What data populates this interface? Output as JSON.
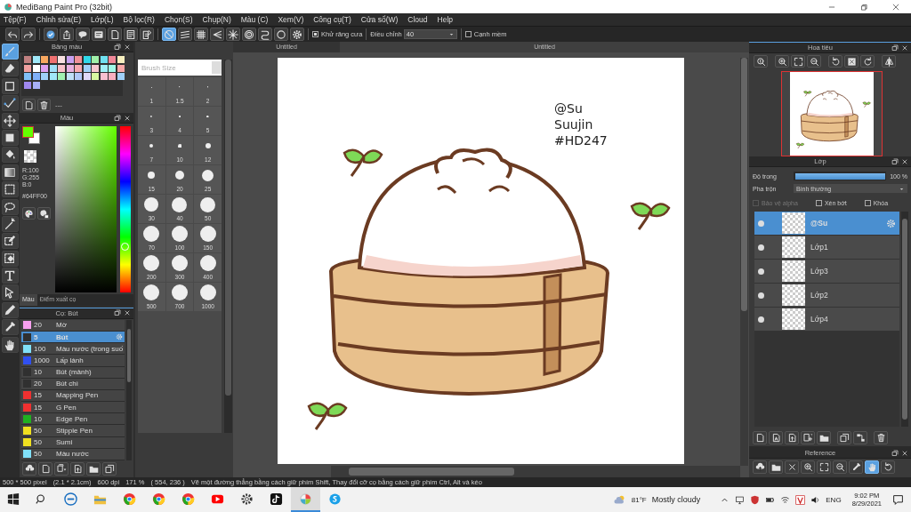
{
  "window": {
    "title": "MediBang Paint Pro (32bit)"
  },
  "menu": [
    "Tệp(F)",
    "Chỉnh sửa(E)",
    "Lớp(L)",
    "Bộ lọc(R)",
    "Chọn(S)",
    "Chụp(N)",
    "Màu (C)",
    "Xem(V)",
    "Công cụ(T)",
    "Cửa sổ(W)",
    "Cloud",
    "Help"
  ],
  "toolbar": {
    "snaps": [
      {
        "selected": true
      },
      {
        "selected": false
      },
      {
        "selected": false
      },
      {
        "selected": false
      },
      {
        "selected": false
      },
      {
        "selected": false
      },
      {
        "selected": false
      },
      {
        "selected": false
      }
    ],
    "antialias": {
      "label": "Khử răng cưa",
      "checked": true
    },
    "correction": {
      "label": "Điều chỉnh",
      "value": "40"
    },
    "soft_edge": {
      "label": "Cạnh mềm",
      "checked": false
    }
  },
  "tools": [
    {
      "selected": true
    },
    {
      "selected": false
    },
    {
      "selected": false
    },
    {
      "selected": false
    },
    {
      "selected": false
    },
    {
      "selected": false
    },
    {
      "selected": false
    },
    {
      "selected": false
    },
    {
      "selected": false
    },
    {
      "selected": false
    },
    {
      "selected": false
    },
    {
      "selected": false
    },
    {
      "selected": false
    },
    {
      "selected": false
    },
    {
      "selected": false
    },
    {
      "selected": false
    },
    {
      "selected": false
    },
    {
      "selected": false
    }
  ],
  "palette": {
    "title": "Bảng màu",
    "set_name": "---",
    "swatches": [
      {
        "color": "#c08080"
      },
      {
        "color": "#a0e8f8"
      },
      {
        "color": "#f8a860"
      },
      {
        "color": "#f07070"
      },
      {
        "color": "#f8e0e0"
      },
      {
        "color": "#c8a0f0"
      },
      {
        "color": "#f09098"
      },
      {
        "color": "#30d8e8"
      },
      {
        "color": "#a0f0a8"
      },
      {
        "color": "#70e0f0"
      },
      {
        "color": "#f08898"
      },
      {
        "color": "#f8f0c0"
      },
      {
        "color": "#f0a0a0"
      },
      {
        "color": "#ffffff"
      },
      {
        "color": "#e0a0f0"
      },
      {
        "color": "#a0e0f8"
      },
      {
        "color": "#f8c0c8"
      },
      {
        "color": "#e8b0e0"
      },
      {
        "color": "#f8a8b0"
      },
      {
        "color": "#a0d0f8"
      },
      {
        "color": "#f8c8d0"
      },
      {
        "color": "#a0f0f8"
      },
      {
        "color": "#a0f8e8"
      },
      {
        "color": "#f8a8a8"
      },
      {
        "color": "#80c0f8"
      },
      {
        "color": "#80b0f8"
      },
      {
        "color": "#a0d0f8"
      },
      {
        "color": "#a0e8f8"
      },
      {
        "color": "#a0f0b0"
      },
      {
        "color": "#c0e0f8"
      },
      {
        "color": "#b0c8f8"
      },
      {
        "color": "#e0d8f8"
      },
      {
        "color": "#d8f8a0"
      },
      {
        "color": "#f8c0d0"
      },
      {
        "color": "#f8b0c0"
      },
      {
        "color": "#a0d0f8"
      },
      {
        "color": "#a088f0"
      },
      {
        "color": "#a8b0f8"
      }
    ]
  },
  "color_panel": {
    "title": "Màu",
    "swatches": [
      {
        "kind": "foreground",
        "color": "#64ff00"
      },
      {
        "kind": "background",
        "color": "#ffffff"
      }
    ],
    "r": "R:100",
    "g": "G:255",
    "b": "B:0",
    "hex": "#64FF00",
    "hue": {
      "level": 0.27
    },
    "tabs": [
      {
        "label": "Màu",
        "selected": true
      },
      {
        "label": "Điểm xuất cọ",
        "selected": false
      }
    ]
  },
  "brush_panel": {
    "title": "Cọ: Bút",
    "brushes": [
      {
        "color": "#f8a0f0",
        "size": "20",
        "name": "Mờ",
        "selected": false
      },
      {
        "color": "#303030",
        "size": "5",
        "name": "Bút",
        "selected": true
      },
      {
        "color": "#80e0f8",
        "size": "100",
        "name": "Màu nước (trong suố",
        "selected": false
      },
      {
        "color": "#3050f0",
        "size": "1000",
        "name": "Lấp lánh",
        "selected": false
      },
      {
        "color": "#303030",
        "size": "10",
        "name": "Bút (mảnh)",
        "selected": false
      },
      {
        "color": "#303030",
        "size": "20",
        "name": "Bút chì",
        "selected": false
      },
      {
        "color": "#f03030",
        "size": "15",
        "name": "Mapping Pen",
        "selected": false
      },
      {
        "color": "#f03030",
        "size": "15",
        "name": "G Pen",
        "selected": false
      },
      {
        "color": "#20b020",
        "size": "10",
        "name": "Edge Pen",
        "selected": false
      },
      {
        "color": "#f0e020",
        "size": "50",
        "name": "Stipple Pen",
        "selected": false
      },
      {
        "color": "#f0e020",
        "size": "50",
        "name": "Sumi",
        "selected": false
      },
      {
        "color": "#80e0f8",
        "size": "50",
        "name": "Màu nước",
        "selected": false
      }
    ]
  },
  "brush_size": {
    "placeholder": "Brush Size",
    "sizes": [
      "1",
      "1.5",
      "2",
      "3",
      "4",
      "5",
      "7",
      "10",
      "12",
      "15",
      "20",
      "25",
      "30",
      "40",
      "50",
      "70",
      "100",
      "150",
      "200",
      "300",
      "400",
      "500",
      "700",
      "1000"
    ]
  },
  "doc_tabs": [
    {
      "label": "Untitled",
      "selected": false
    },
    {
      "label": "Untitled",
      "selected": true
    }
  ],
  "canvas": {
    "texts": [
      "@Su",
      "Suujin",
      "#HD247"
    ]
  },
  "navigator": {
    "title": "Hoa tiêu"
  },
  "layer_panel": {
    "title": "Lớp",
    "opacity": {
      "label": "Độ trong",
      "level": 1,
      "reading": "100 %"
    },
    "blend": {
      "label": "Pha trộn",
      "value": "Bình thường"
    },
    "options": [
      {
        "label": "Bảo vệ alpha",
        "checked": false,
        "disabled": true
      },
      {
        "label": "Xén bớt",
        "checked": false,
        "disabled": false
      },
      {
        "label": "Khóa",
        "checked": false,
        "disabled": false
      }
    ],
    "layers": [
      {
        "name": "@Su",
        "visible": true,
        "selected": true
      },
      {
        "name": "Lớp1",
        "visible": true,
        "selected": false
      },
      {
        "name": "Lớp3",
        "visible": true,
        "selected": false
      },
      {
        "name": "Lớp2",
        "visible": true,
        "selected": false
      },
      {
        "name": "Lớp4",
        "visible": true,
        "selected": false
      }
    ]
  },
  "reference": {
    "title": "Reference",
    "tools": [
      {
        "selected": false
      },
      {
        "selected": false
      },
      {
        "selected": false
      },
      {
        "selected": false
      },
      {
        "selected": false
      },
      {
        "selected": false
      },
      {
        "selected": false
      },
      {
        "selected": true
      },
      {
        "selected": false
      }
    ]
  },
  "status_bar": {
    "size": "500 * 500 pixel",
    "cm": "(2.1 * 2.1cm)",
    "dpi": "600 dpi",
    "zoom": "171 %",
    "cursor": "( 554, 236 )",
    "hint": "Vẽ một đường thẳng bằng cách giữ phím Shift, Thay đổi cỡ cọ bằng cách giữ phím Ctrl, Alt và kéo"
  },
  "taskbar": {
    "apps": [
      {
        "selected": false
      },
      {
        "selected": false
      },
      {
        "selected": false
      },
      {
        "selected": false
      },
      {
        "selected": false
      },
      {
        "selected": false
      },
      {
        "selected": false
      },
      {
        "selected": false
      },
      {
        "selected": true
      },
      {
        "selected": false
      }
    ],
    "temperature": "81°F",
    "weather": "Mostly cloudy",
    "language": "ENG",
    "time": "9:02 PM",
    "date": "8/29/2021"
  }
}
